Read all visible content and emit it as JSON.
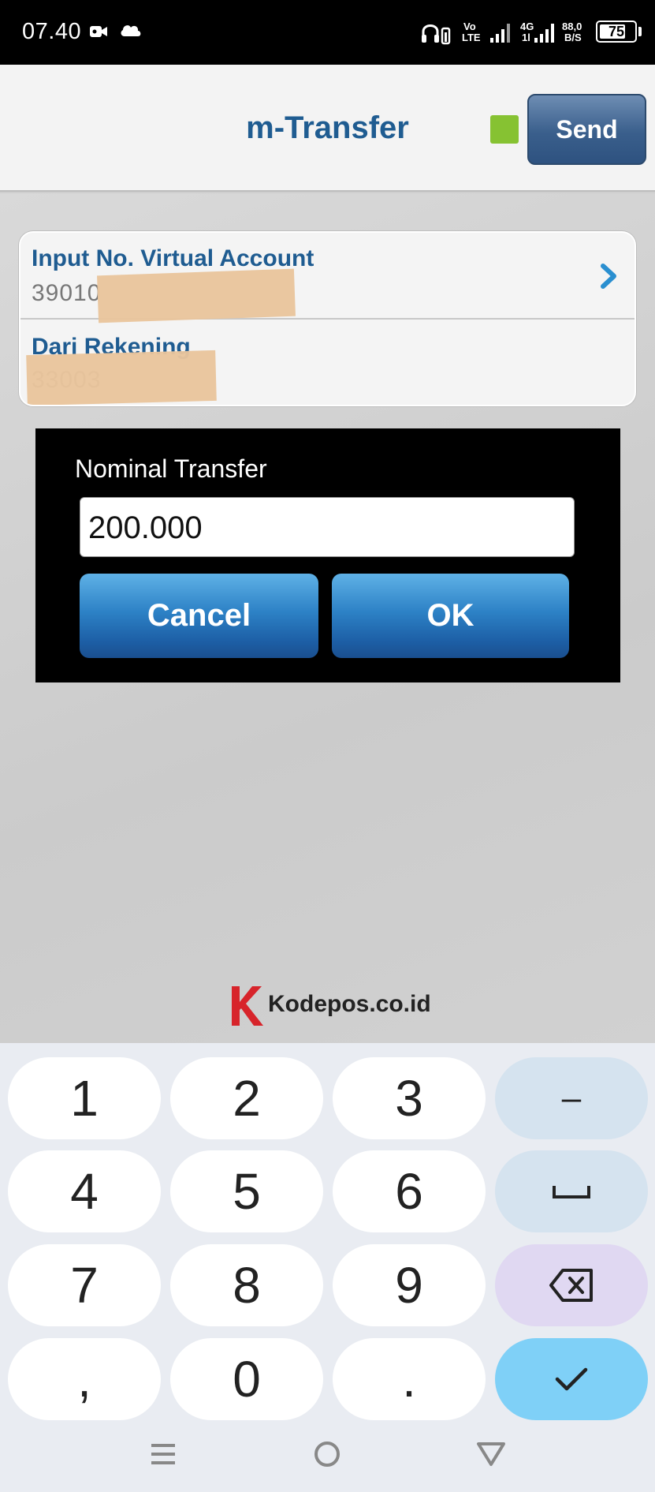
{
  "status_bar": {
    "time": "07.40",
    "network_top": "Vo",
    "network_bottom": "LTE",
    "gen_top": "4G",
    "gen_bottom": "1l",
    "speed_top": "88,0",
    "speed_bottom": "B/S",
    "battery": "75",
    "battery_level": 0.75
  },
  "header": {
    "title": "m-Transfer",
    "send_label": "Send",
    "status_color": "#86c232"
  },
  "form": {
    "va_label": "Input No. Virtual Account",
    "va_value": "39010",
    "from_label": "Dari Rekening",
    "from_value": "33003"
  },
  "dialog": {
    "title": "Nominal Transfer",
    "input_value": "200.000",
    "cancel_label": "Cancel",
    "ok_label": "OK"
  },
  "watermark": {
    "text": "Kodepos.co.id"
  },
  "keyboard": {
    "keys": [
      "1",
      "2",
      "3",
      "–",
      "4",
      "5",
      "6",
      "space",
      "7",
      "8",
      "9",
      "backspace",
      ",",
      "0",
      ".",
      "done"
    ]
  },
  "colors": {
    "accent": "#1f5c91",
    "button_blue": "#2d82c6",
    "done_key": "#7fd0f7"
  }
}
